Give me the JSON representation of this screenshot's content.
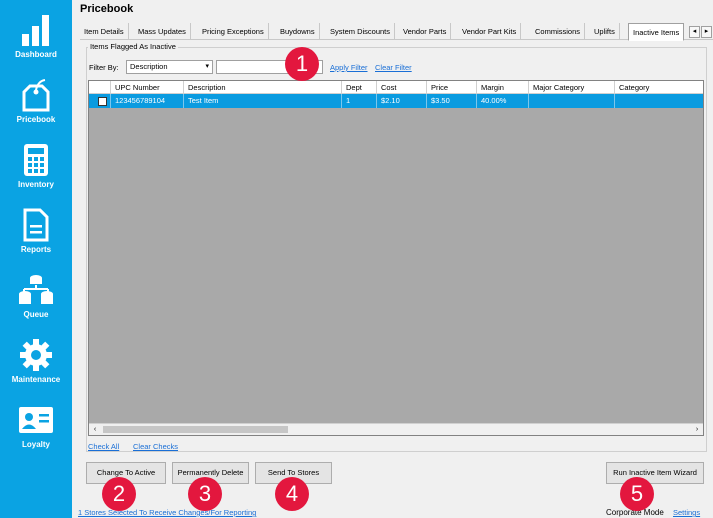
{
  "sidebar": {
    "items": [
      {
        "label": "Dashboard",
        "icon": "bar-chart-icon"
      },
      {
        "label": "Pricebook",
        "icon": "price-tag-icon"
      },
      {
        "label": "Inventory",
        "icon": "calculator-icon"
      },
      {
        "label": "Reports",
        "icon": "document-icon"
      },
      {
        "label": "Queue",
        "icon": "queue-icon"
      },
      {
        "label": "Maintenance",
        "icon": "gear-icon"
      },
      {
        "label": "Loyalty",
        "icon": "id-card-icon"
      }
    ]
  },
  "page": {
    "title": "Pricebook"
  },
  "tabs": [
    {
      "label": "Item Details"
    },
    {
      "label": "Mass Updates"
    },
    {
      "label": "Pricing Exceptions"
    },
    {
      "label": "Buydowns"
    },
    {
      "label": "System Discounts"
    },
    {
      "label": "Vendor Parts"
    },
    {
      "label": "Vendor Part Kits"
    },
    {
      "label": "Commissions"
    },
    {
      "label": "Uplifts"
    },
    {
      "label": "Inactive Items",
      "active": true
    }
  ],
  "group": {
    "title": "Items Flagged As Inactive"
  },
  "filter": {
    "label": "Filter By:",
    "selected": "Description",
    "value": "",
    "apply": "Apply Filter",
    "clear": "Clear Filter"
  },
  "grid": {
    "columns": [
      "",
      "UPC Number",
      "Description",
      "Dept",
      "Cost",
      "Price",
      "Margin",
      "Major Category",
      "Category"
    ],
    "rows": [
      {
        "upc": "123456789104",
        "description": "Test Item",
        "dept": "1",
        "cost": "$2.10",
        "price": "$3.50",
        "margin": "40.00%",
        "major_category": "",
        "category": "",
        "checked": false
      }
    ]
  },
  "grid_links": {
    "check_all": "Check All",
    "clear_checks": "Clear Checks"
  },
  "buttons": {
    "change_to_active": "Change To Active",
    "permanently_delete": "Permanently Delete",
    "send_to_stores": "Send To Stores",
    "run_wizard": "Run Inactive Item Wizard"
  },
  "badges": [
    "1",
    "2",
    "3",
    "4",
    "5"
  ],
  "footer": {
    "stores_link": "1 Stores Selected To Receive Changes/For Reporting",
    "mode": "Corporate Mode",
    "settings": "Settings"
  },
  "colors": {
    "sidebar": "#0aa3e3",
    "selection": "#0a9be0",
    "badge": "#e3173e",
    "link": "#1a6fd6"
  }
}
